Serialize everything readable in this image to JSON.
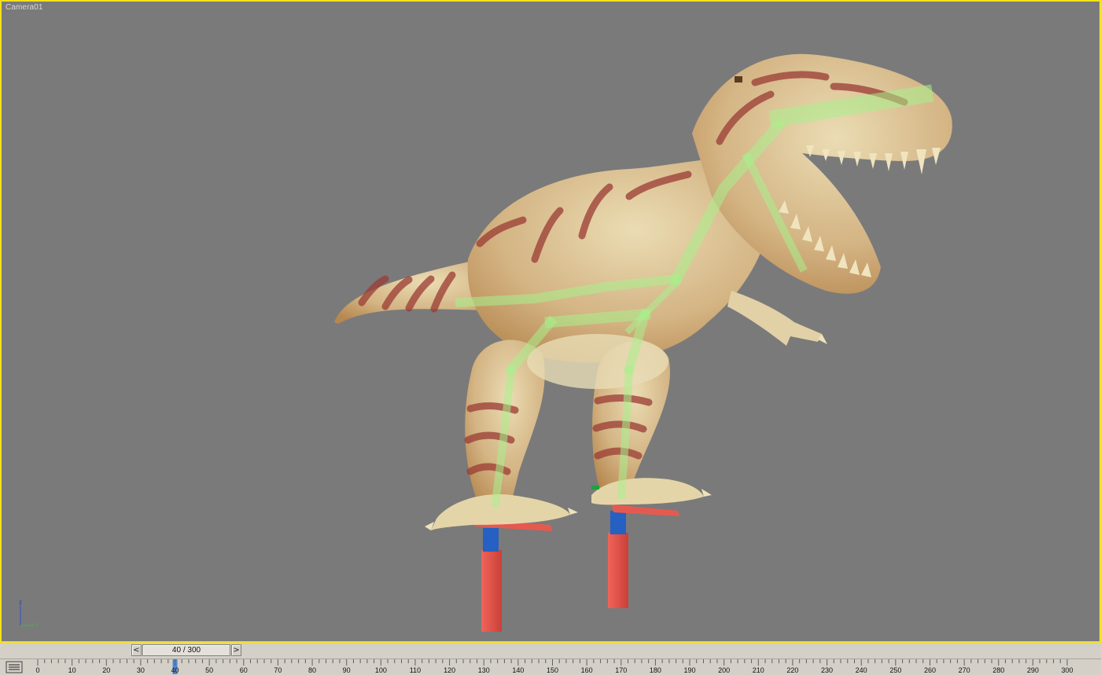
{
  "viewport": {
    "label": "Camera01",
    "background": "#7a7a7a",
    "border_color": "#f2e21a",
    "axis_gizmo": {
      "z_label": "z",
      "x_label": "x"
    }
  },
  "timeslider": {
    "prev_icon": "chevron-left-icon",
    "next_icon": "chevron-right-icon",
    "prev_glyph": "<",
    "next_glyph": ">",
    "readout": "40 / 300",
    "current_frame": 40,
    "total_frames": 300
  },
  "trackbar": {
    "icon": "track-bar-filter-icon",
    "tick_labels": [
      "0",
      "10",
      "20",
      "30",
      "40",
      "50",
      "60",
      "70",
      "80",
      "90",
      "100",
      "110",
      "120",
      "130",
      "140",
      "150",
      "160",
      "170",
      "180",
      "190",
      "200",
      "210",
      "220",
      "230",
      "240",
      "250",
      "260",
      "270",
      "280",
      "290",
      "300"
    ],
    "current_marker": 40,
    "marker_color": "#2a6ec8"
  },
  "colors": {
    "skin": "#e6d4a4",
    "stripes": "#9c3a32",
    "bones": "#9ce08a",
    "pole_red": "#e5584e",
    "pole_blue": "#2060c0"
  }
}
